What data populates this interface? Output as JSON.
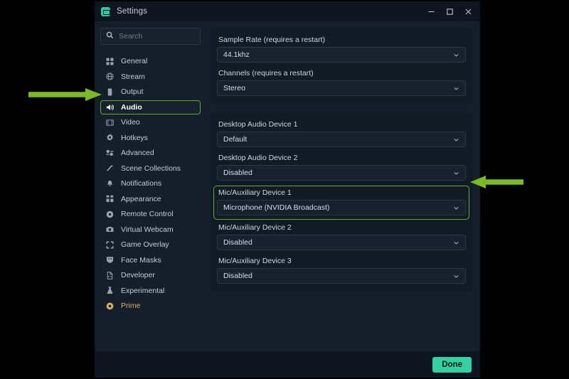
{
  "window": {
    "title": "Settings",
    "icon": "settings-app-icon",
    "controls": [
      {
        "name": "minimize",
        "glyph": "minimize-icon"
      },
      {
        "name": "maximize",
        "glyph": "maximize-icon"
      },
      {
        "name": "close",
        "glyph": "close-icon"
      }
    ]
  },
  "sidebar": {
    "search": {
      "placeholder": "Search",
      "value": "",
      "icon": "search-icon"
    },
    "items": [
      {
        "label": "General",
        "icon": "grid-icon",
        "active": false
      },
      {
        "label": "Stream",
        "icon": "globe-icon",
        "active": false
      },
      {
        "label": "Output",
        "icon": "device-icon",
        "active": false
      },
      {
        "label": "Audio",
        "icon": "speaker-icon",
        "active": true
      },
      {
        "label": "Video",
        "icon": "monitor-icon",
        "active": false
      },
      {
        "label": "Hotkeys",
        "icon": "gear-icon",
        "active": false
      },
      {
        "label": "Advanced",
        "icon": "sliders-icon",
        "active": false
      },
      {
        "label": "Scene Collections",
        "icon": "wand-icon",
        "active": false
      },
      {
        "label": "Notifications",
        "icon": "bell-icon",
        "active": false
      },
      {
        "label": "Appearance",
        "icon": "layout-icon",
        "active": false
      },
      {
        "label": "Remote Control",
        "icon": "record-icon",
        "active": false
      },
      {
        "label": "Virtual Webcam",
        "icon": "camera-icon",
        "active": false
      },
      {
        "label": "Game Overlay",
        "icon": "expand-icon",
        "active": false
      },
      {
        "label": "Face Masks",
        "icon": "mask-icon",
        "active": false
      },
      {
        "label": "Developer",
        "icon": "file-code-icon",
        "active": false
      },
      {
        "label": "Experimental",
        "icon": "flask-icon",
        "active": false
      },
      {
        "label": "Prime",
        "icon": "prime-icon",
        "active": false
      }
    ]
  },
  "content": {
    "cards": [
      {
        "fields": [
          {
            "label": "Sample Rate (requires a restart)",
            "value": "44.1khz",
            "highlight": false
          },
          {
            "label": "Channels (requires a restart)",
            "value": "Stereo",
            "highlight": false
          }
        ]
      },
      {
        "fields": [
          {
            "label": "Desktop Audio Device 1",
            "value": "Default",
            "highlight": false
          },
          {
            "label": "Desktop Audio Device 2",
            "value": "Disabled",
            "highlight": false
          },
          {
            "label": "Mic/Auxiliary Device 1",
            "value": "Microphone (NVIDIA Broadcast)",
            "highlight": true
          },
          {
            "label": "Mic/Auxiliary Device 2",
            "value": "Disabled",
            "highlight": false
          },
          {
            "label": "Mic/Auxiliary Device 3",
            "value": "Disabled",
            "highlight": false
          }
        ]
      }
    ]
  },
  "footer": {
    "done_label": "Done"
  },
  "annotations": [
    {
      "name": "arrow-pointing-to-audio-tab",
      "direction": "right"
    },
    {
      "name": "arrow-pointing-to-mic-device",
      "direction": "left"
    }
  ],
  "colors": {
    "accent_green": "#6aa828",
    "arrow_green": "#7ab928",
    "done_teal": "#34cfa3",
    "prime_gold": "#d6b45c",
    "window_bg": "#151f2b",
    "card_bg": "#101b26",
    "titlebar_bg": "#0d1620"
  }
}
